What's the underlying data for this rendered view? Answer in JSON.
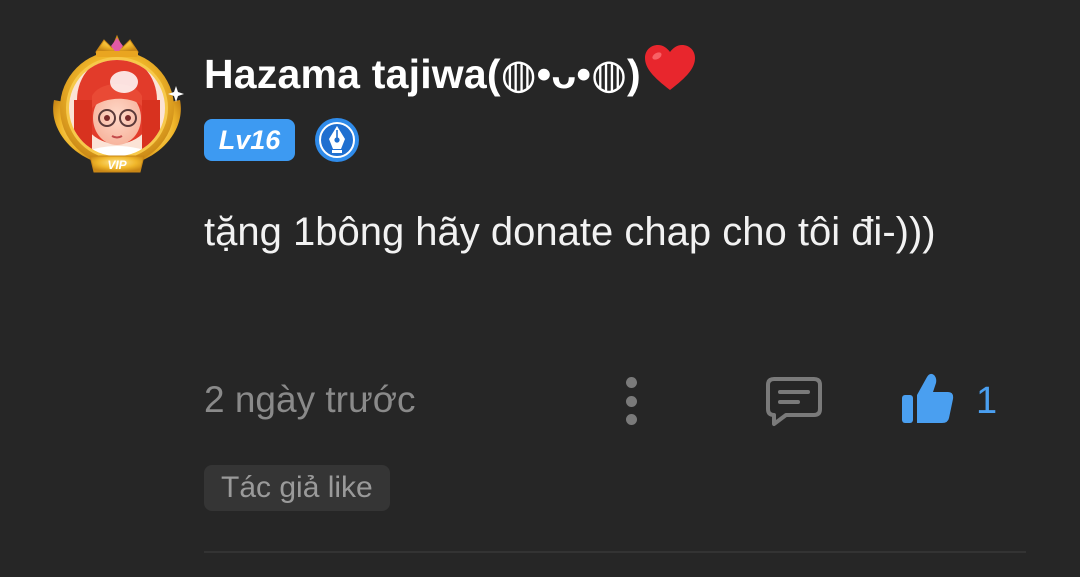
{
  "comment": {
    "username": "Hazama tajiwa(◍•ᴗ•◍)",
    "username_emoji": "heart-emoji",
    "avatar": {
      "frame_label": "VIP",
      "frame_color": "#f0b62a"
    },
    "level_badge": "Lv16",
    "secondary_badge": "pen-nib-icon",
    "text": "tặng 1bông hãy donate chap cho tôi đi-)))",
    "timestamp": "2 ngày trước",
    "actions": {
      "more_icon": "more-vertical-icon",
      "reply_icon": "comment-icon",
      "like_icon": "thumbs-up-icon",
      "like_count": "1"
    },
    "author_like_tag": "Tác giả like"
  },
  "colors": {
    "background": "#262626",
    "accent_blue": "#3d9af2",
    "muted_text": "#8a8a8a",
    "heart": "#e8262d"
  }
}
